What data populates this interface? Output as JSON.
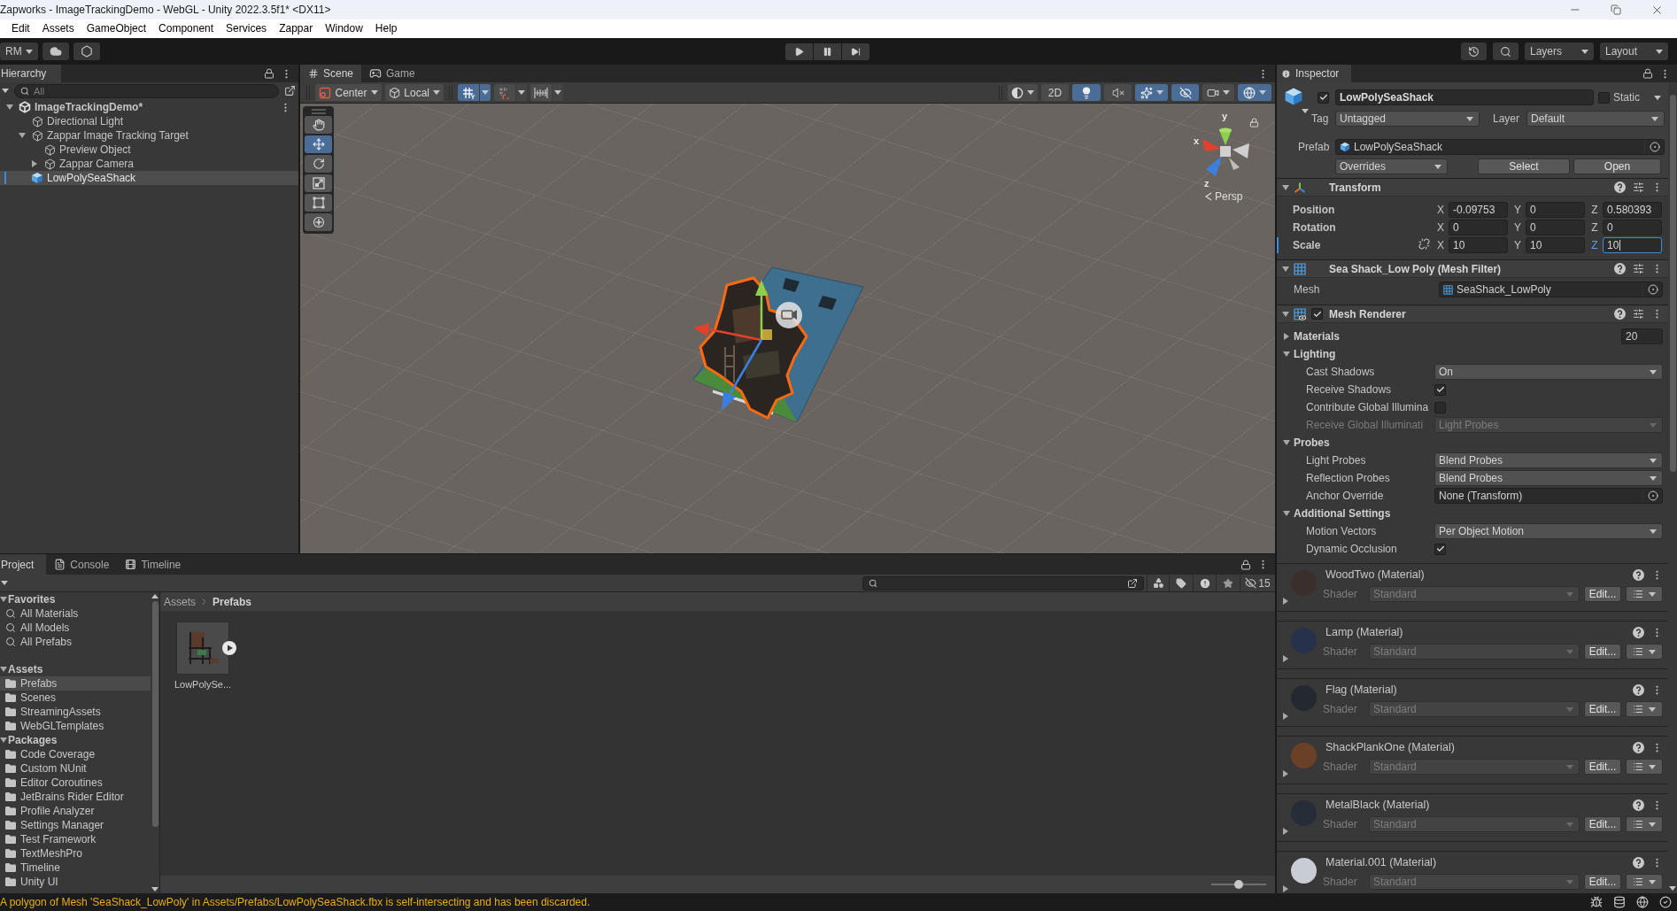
{
  "window": {
    "title": "Zapworks - ImageTrackingDemo - WebGL - Unity 2022.3.5f1* <DX11>"
  },
  "menu": [
    "Edit",
    "Assets",
    "GameObject",
    "Component",
    "Services",
    "Zappar",
    "Window",
    "Help"
  ],
  "toolbar": {
    "account": "RM",
    "layers": "Layers",
    "layout": "Layout"
  },
  "hierarchy": {
    "tab": "Hierarchy",
    "search": {
      "placeholder": "All"
    },
    "tree": [
      {
        "name": "ImageTrackingDemo*",
        "kind": "scene",
        "expanded": true,
        "selected": false,
        "children": [
          {
            "name": "Directional Light",
            "kind": "object",
            "selected": false
          },
          {
            "name": "Zappar Image Tracking Target",
            "kind": "object",
            "expanded": true,
            "selected": false,
            "children": [
              {
                "name": "Preview Object",
                "kind": "object",
                "selected": false
              },
              {
                "name": "Zappar Camera",
                "kind": "object",
                "expanded": false,
                "selected": false
              }
            ]
          },
          {
            "name": "LowPolySeaShack",
            "kind": "prefab",
            "selected": true
          }
        ]
      }
    ]
  },
  "scene": {
    "tabs": [
      {
        "label": "Scene",
        "kind": "scene",
        "selected": true
      },
      {
        "label": "Game",
        "kind": "game",
        "selected": false
      }
    ],
    "pivot": "Center",
    "space": "Local",
    "snap_toggles": [
      {
        "kind": "grid",
        "on": true
      },
      {
        "kind": "increment",
        "on": false
      },
      {
        "kind": "ruler",
        "on": false
      }
    ],
    "view_toggles": [
      {
        "kind": "shading",
        "on": false
      },
      {
        "kind": "dimension",
        "label": "2D",
        "on": false
      },
      {
        "kind": "lighting",
        "on": true
      },
      {
        "kind": "audio",
        "on": false
      },
      {
        "kind": "effects",
        "on": true
      },
      {
        "kind": "visibility",
        "on": true
      },
      {
        "kind": "camera",
        "on": false
      },
      {
        "kind": "gizmos",
        "on": true
      }
    ],
    "tools": [
      {
        "kind": "hand",
        "selected": false
      },
      {
        "kind": "move",
        "selected": true
      },
      {
        "kind": "rotate",
        "selected": false
      },
      {
        "kind": "scale",
        "selected": false
      },
      {
        "kind": "rect",
        "selected": false
      },
      {
        "kind": "transform",
        "selected": false
      }
    ],
    "axes": [
      {
        "kind": "y",
        "label": "y"
      },
      {
        "kind": "x",
        "label": "x"
      },
      {
        "kind": "z",
        "label": "z"
      }
    ],
    "projection": "Persp"
  },
  "inspector": {
    "tab": "Inspector",
    "object": {
      "name": "LowPolySeaShack",
      "active": true,
      "static_label": "Static",
      "static": false,
      "tag_label": "Tag",
      "tag": "Untagged",
      "layer_label": "Layer",
      "layer": "Default",
      "prefab_label": "Prefab",
      "prefab": "LowPolySeaShack",
      "overrides": "Overrides",
      "buttons": [
        "Select",
        "Open"
      ]
    },
    "transform": {
      "title": "Transform",
      "expanded": true,
      "rows": [
        {
          "label": "Position",
          "overridden": false,
          "fields": [
            {
              "axis": "X",
              "value": "-0.09753",
              "focused": false
            },
            {
              "axis": "Y",
              "value": "0",
              "focused": false
            },
            {
              "axis": "Z",
              "value": "0.580393",
              "focused": false
            }
          ]
        },
        {
          "label": "Rotation",
          "overridden": false,
          "fields": [
            {
              "axis": "X",
              "value": "0",
              "focused": false
            },
            {
              "axis": "Y",
              "value": "0",
              "focused": false
            },
            {
              "axis": "Z",
              "value": "0",
              "focused": false
            }
          ]
        },
        {
          "label": "Scale",
          "overridden": true,
          "proportional": false,
          "fields": [
            {
              "axis": "X",
              "value": "10",
              "focused": false
            },
            {
              "axis": "Y",
              "value": "10",
              "focused": false
            },
            {
              "axis": "Z",
              "value": "10",
              "focused": true
            }
          ]
        }
      ]
    },
    "mesh_filter": {
      "title": "Sea Shack_Low Poly (Mesh Filter)",
      "expanded": true,
      "label": "Mesh",
      "value": "SeaShack_LowPoly"
    },
    "mesh_renderer": {
      "title": "Mesh Renderer",
      "enabled": true,
      "expanded": true,
      "properties": [
        {
          "kind": "foldout",
          "label": "Materials",
          "expanded": false,
          "value": "20"
        },
        {
          "kind": "section",
          "label": "Lighting",
          "expanded": true,
          "children": [
            {
              "kind": "dropdown",
              "label": "Cast Shadows",
              "value": "On",
              "disabled": false
            },
            {
              "kind": "checkbox",
              "label": "Receive Shadows",
              "checked": true
            },
            {
              "kind": "checkbox",
              "label": "Contribute Global Illumina",
              "checked": false
            },
            {
              "kind": "dropdown",
              "label": "Receive Global Illuminati",
              "value": "Light Probes",
              "disabled": true
            }
          ]
        },
        {
          "kind": "section",
          "label": "Probes",
          "expanded": true,
          "children": [
            {
              "kind": "dropdown",
              "label": "Light Probes",
              "value": "Blend Probes",
              "disabled": false
            },
            {
              "kind": "dropdown",
              "label": "Reflection Probes",
              "value": "Blend Probes",
              "disabled": false
            },
            {
              "kind": "object",
              "label": "Anchor Override",
              "value": "None (Transform)"
            }
          ]
        },
        {
          "kind": "section",
          "label": "Additional Settings",
          "expanded": true,
          "children": [
            {
              "kind": "dropdown",
              "label": "Motion Vectors",
              "value": "Per Object Motion",
              "disabled": false
            },
            {
              "kind": "checkbox",
              "label": "Dynamic Occlusion",
              "checked": true
            }
          ]
        }
      ]
    },
    "materials": [
      {
        "name": "WoodTwo (Material)",
        "color": "#3a2f2b",
        "shader_label": "Shader",
        "shader": "Standard",
        "edit": "Edit..."
      },
      {
        "name": "Lamp (Material)",
        "color": "#27324a",
        "shader_label": "Shader",
        "shader": "Standard",
        "edit": "Edit..."
      },
      {
        "name": "Flag (Material)",
        "color": "#24292f",
        "shader_label": "Shader",
        "shader": "Standard",
        "edit": "Edit..."
      },
      {
        "name": "ShackPlankOne (Material)",
        "color": "#6a4127",
        "shader_label": "Shader",
        "shader": "Standard",
        "edit": "Edit..."
      },
      {
        "name": "MetalBlack (Material)",
        "color": "#262d38",
        "shader_label": "Shader",
        "shader": "Standard",
        "edit": "Edit..."
      },
      {
        "name": "Material.001 (Material)",
        "color": "#c9cdd3",
        "shader_label": "Shader",
        "shader": "Standard",
        "edit": "Edit..."
      }
    ]
  },
  "project": {
    "tabs": [
      {
        "label": "Project",
        "kind": "project",
        "selected": true
      },
      {
        "label": "Console",
        "kind": "console",
        "selected": false
      },
      {
        "label": "Timeline",
        "kind": "timeline",
        "selected": false
      }
    ],
    "tree": [
      {
        "name": "Favorites",
        "kind": "group",
        "expanded": true,
        "selected": false,
        "children": [
          {
            "name": "All Materials",
            "kind": "search",
            "selected": false
          },
          {
            "name": "All Models",
            "kind": "search",
            "selected": false
          },
          {
            "name": "All Prefabs",
            "kind": "search",
            "selected": false
          }
        ]
      },
      {
        "name": "Assets",
        "kind": "group",
        "expanded": true,
        "selected": false,
        "children": [
          {
            "name": "Prefabs",
            "kind": "folder",
            "selected": true
          },
          {
            "name": "Scenes",
            "kind": "folder",
            "selected": false
          },
          {
            "name": "StreamingAssets",
            "kind": "folder",
            "selected": false
          },
          {
            "name": "WebGLTemplates",
            "kind": "folder",
            "selected": false
          }
        ]
      },
      {
        "name": "Packages",
        "kind": "group",
        "expanded": true,
        "selected": false,
        "children": [
          {
            "name": "Code Coverage",
            "kind": "folder",
            "selected": false
          },
          {
            "name": "Custom NUnit",
            "kind": "folder",
            "selected": false
          },
          {
            "name": "Editor Coroutines",
            "kind": "folder",
            "selected": false
          },
          {
            "name": "JetBrains Rider Editor",
            "kind": "folder",
            "selected": false
          },
          {
            "name": "Profile Analyzer",
            "kind": "folder",
            "selected": false
          },
          {
            "name": "Settings Manager",
            "kind": "folder",
            "selected": false
          },
          {
            "name": "Test Framework",
            "kind": "folder",
            "selected": false
          },
          {
            "name": "TextMeshPro",
            "kind": "folder",
            "selected": false
          },
          {
            "name": "Timeline",
            "kind": "folder",
            "selected": false
          },
          {
            "name": "Unity UI",
            "kind": "folder",
            "selected": false
          }
        ]
      }
    ],
    "breadcrumb": [
      "Assets",
      "Prefabs"
    ],
    "assets": [
      {
        "name": "LowPolySe...",
        "kind": "prefab",
        "selected": false
      }
    ],
    "hidden_count": "15",
    "zoom": {
      "level": 0.5
    }
  },
  "status_bar": {
    "kind": "warning",
    "message": "A polygon of Mesh 'SeaShack_LowPoly' in Assets/Prefabs/LowPolySeaShack.fbx is self-intersecting and has been discarded."
  }
}
